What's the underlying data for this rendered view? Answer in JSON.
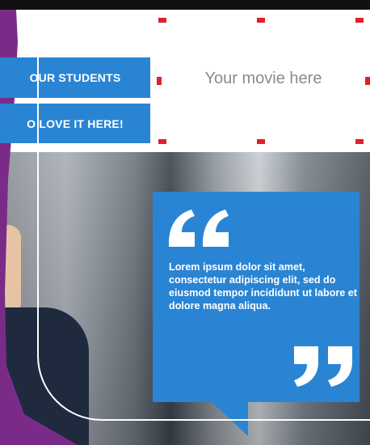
{
  "buttons": {
    "students_label": "OUR STUDENTS",
    "love_label": "O LOVE IT HERE!"
  },
  "movie": {
    "placeholder": "Your movie here"
  },
  "quote": {
    "text": "Lorem ipsum dolor sit amet, consectetur adipiscing elit, sed do eiusmod tempor incididunt ut labore et dolore magna aliqua."
  },
  "colors": {
    "blue": "#2a84d4",
    "purple": "#7a2b87",
    "red": "#e0202a"
  },
  "icons": {
    "open_quote": "quote-open-icon",
    "close_quote": "quote-close-icon"
  }
}
